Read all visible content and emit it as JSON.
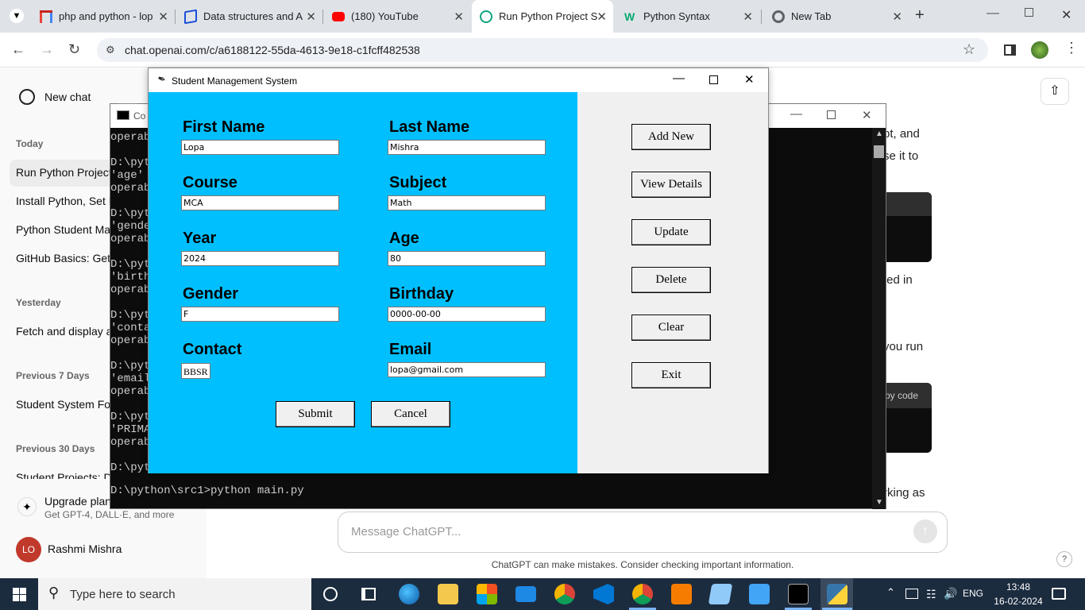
{
  "browser": {
    "tabs": [
      {
        "label": "php and python - lop"
      },
      {
        "label": "Data structures and A"
      },
      {
        "label": "(180) YouTube"
      },
      {
        "label": "Run Python Project S"
      },
      {
        "label": "Python Syntax"
      },
      {
        "label": "New Tab"
      }
    ],
    "address": "chat.openai.com/c/a6188122-55da-4613-9e18-c1fcff482538"
  },
  "sidebar": {
    "new_chat": "New chat",
    "sections": [
      {
        "heading": "Today",
        "items": [
          "Run Python Project",
          "Install Python, Set F",
          "Python Student Ma",
          "GitHub Basics: Get"
        ]
      },
      {
        "heading": "Yesterday",
        "items": [
          "Fetch and display a"
        ]
      },
      {
        "heading": "Previous 7 Days",
        "items": [
          "Student System Fo"
        ]
      },
      {
        "heading": "Previous 30 Days",
        "items": [
          "Student Projects: D"
        ]
      }
    ],
    "upgrade_title": "Upgrade plan",
    "upgrade_sub": "Get GPT-4, DALL·E, and more",
    "user_initials": "LO",
    "user_name": "Rashmi Mishra"
  },
  "chat": {
    "fragments": [
      "pt, and",
      "se it to",
      "ted in",
      "you run",
      "py code",
      "rking as"
    ],
    "placeholder": "Message ChatGPT...",
    "disclaimer": "ChatGPT can make mistakes. Consider checking important information.",
    "help": "?"
  },
  "console": {
    "title": "Co",
    "lines": [
      "operab",
      "",
      "D:\\pyt",
      "'age' ",
      "operab",
      "",
      "D:\\pyt",
      "'gende",
      "operab",
      "",
      "D:\\pyt",
      "'birth",
      "operab",
      "",
      "D:\\pyt",
      "'conta",
      "operab",
      "",
      "D:\\pyt",
      "'email",
      "operab",
      "",
      "D:\\pyt",
      "'PRIMA",
      "operab",
      "",
      "D:\\pyt"
    ],
    "prompt": "D:\\python\\src1>python main.py"
  },
  "app": {
    "title": "Student Management System",
    "fields": [
      {
        "label": "First Name",
        "value": "Lopa"
      },
      {
        "label": "Last Name",
        "value": "Mishra"
      },
      {
        "label": "Course",
        "value": "MCA"
      },
      {
        "label": "Subject",
        "value": "Math"
      },
      {
        "label": "Year",
        "value": "2024"
      },
      {
        "label": "Age",
        "value": "80"
      },
      {
        "label": "Gender",
        "value": "F"
      },
      {
        "label": "Birthday",
        "value": "0000-00-00"
      },
      {
        "label": "Contact",
        "value": "BBSR"
      },
      {
        "label": "Email",
        "value": "lopa@gmail.com"
      }
    ],
    "submit": "Submit",
    "cancel": "Cancel",
    "actions": [
      "Add New",
      "View Details",
      "Update",
      "Delete",
      "Clear",
      "Exit"
    ],
    "form_bg": "#00bfff"
  },
  "taskbar": {
    "search_placeholder": "Type here to search",
    "lang": "ENG",
    "time": "13:48",
    "date": "16-02-2024"
  }
}
